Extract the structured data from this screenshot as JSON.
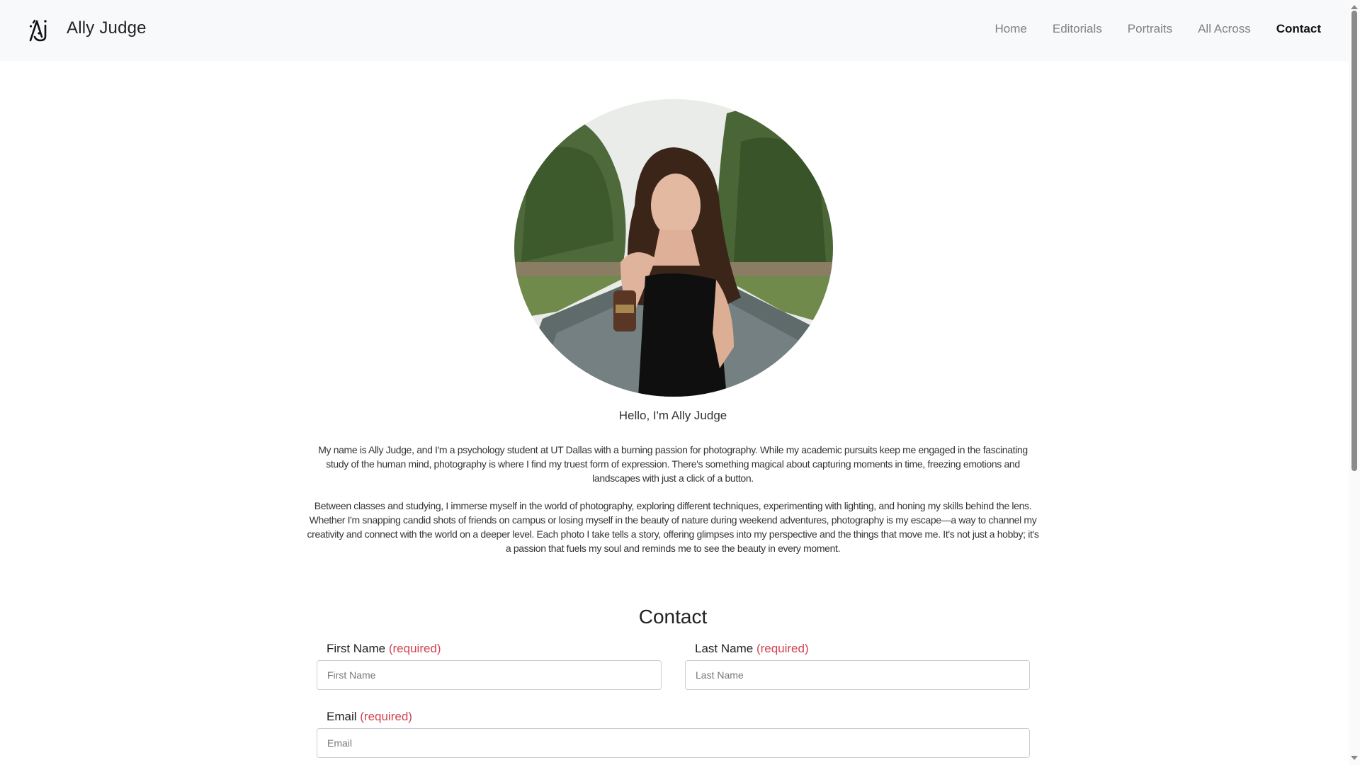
{
  "header": {
    "site_title": "Ally Judge",
    "logo_icon": "aj-monogram-logo",
    "nav": [
      {
        "label": "Home",
        "active": false
      },
      {
        "label": "Editorials",
        "active": false
      },
      {
        "label": "Portraits",
        "active": false
      },
      {
        "label": "All Across",
        "active": false
      },
      {
        "label": "Contact",
        "active": true
      }
    ]
  },
  "hero": {
    "photo_alt": "Portrait of Ally Judge holding a gavel in front of a fountain and trees",
    "greeting": "Hello, I'm Ally Judge",
    "bio": [
      "My name is Ally Judge, and I'm a psychology student at UT Dallas with a burning passion for photography. While my academic pursuits keep me engaged in the fascinating study of the human mind, photography is where I find my truest form of expression. There's something magical about capturing moments in time, freezing emotions and landscapes with just a click of a button.",
      "Between classes and studying, I immerse myself in the world of photography, exploring different techniques, experimenting with lighting, and honing my skills behind the lens. Whether I'm snapping candid shots of friends on campus or losing myself in the beauty of nature during weekend adventures, photography is my escape—a way to channel my creativity and connect with the world on a deeper level. Each photo I take tells a story, offering glimpses into my perspective and the things that move me. It's not just a hobby; it's a passion that fuels my soul and reminds me to see the beauty in every moment."
    ]
  },
  "contact": {
    "title": "Contact",
    "required_text": "(required)",
    "fields": {
      "first_name": {
        "label": "First Name",
        "placeholder": "First Name",
        "value": ""
      },
      "last_name": {
        "label": "Last Name",
        "placeholder": "Last Name",
        "value": ""
      },
      "email": {
        "label": "Email",
        "placeholder": "Email",
        "value": ""
      }
    }
  },
  "colors": {
    "header_bg": "#f8f9fa",
    "nav_inactive": "#808080",
    "nav_active": "#111111",
    "required": "#d14352",
    "input_border": "#c9ced4"
  }
}
